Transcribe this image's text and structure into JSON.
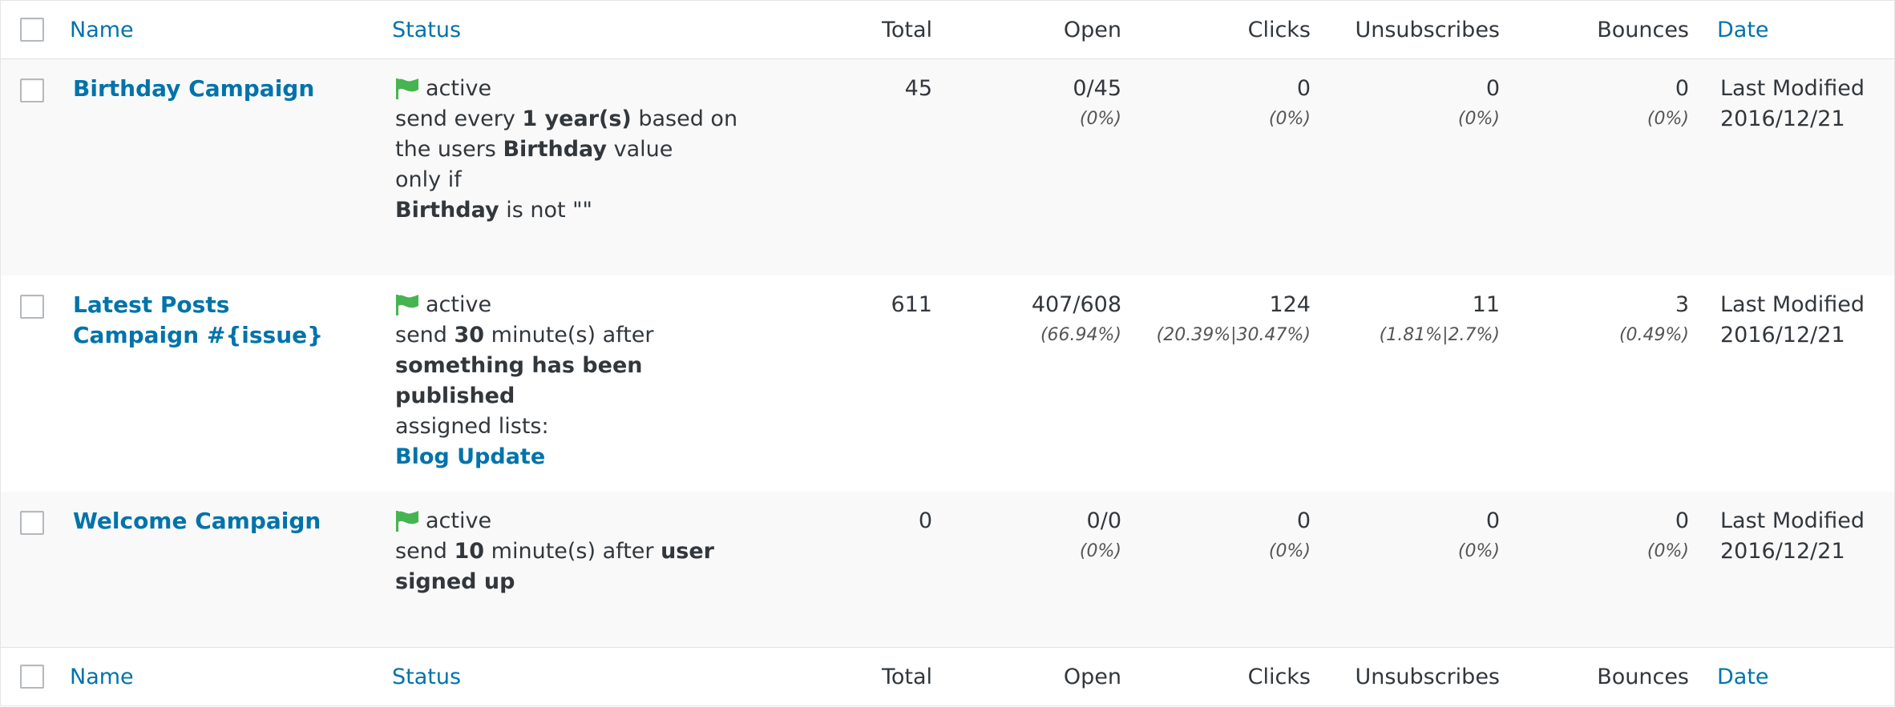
{
  "columns": {
    "name": "Name",
    "status": "Status",
    "total": "Total",
    "open": "Open",
    "clicks": "Clicks",
    "unsubscribes": "Unsubscribes",
    "bounces": "Bounces",
    "date": "Date"
  },
  "campaigns": [
    {
      "name": "Birthday Campaign",
      "status": "active",
      "desc_1a": "send every ",
      "desc_1b": "1 year(s)",
      "desc_1c": " based on the users ",
      "desc_1d": "Birthday",
      "desc_1e": " value",
      "desc_2": "only if",
      "desc_3a": "Birthday",
      "desc_3b": " is not \"\"",
      "total": "45",
      "open": "0/45",
      "open_pct": "(0%)",
      "clicks": "0",
      "clicks_pct": "(0%)",
      "unsubscribes": "0",
      "unsubscribes_pct": "(0%)",
      "bounces": "0",
      "bounces_pct": "(0%)",
      "date_label": "Last Modified",
      "date": "2016/12/21"
    },
    {
      "name": "Latest Posts Campaign #{issue}",
      "status": "active",
      "desc_1a": "send ",
      "desc_1b": "30",
      "desc_1c": " minute(s) after ",
      "desc_1d": "something has been published",
      "desc_2": "assigned lists:",
      "list_link": "Blog Update",
      "total": "611",
      "open": "407/608",
      "open_pct": "(66.94%)",
      "clicks": "124",
      "clicks_pct": "(20.39%|30.47%)",
      "unsubscribes": "11",
      "unsubscribes_pct": "(1.81%|2.7%)",
      "bounces": "3",
      "bounces_pct": "(0.49%)",
      "date_label": "Last Modified",
      "date": "2016/12/21"
    },
    {
      "name": "Welcome Campaign",
      "status": "active",
      "desc_1a": "send ",
      "desc_1b": "10",
      "desc_1c": " minute(s) after ",
      "desc_1d": "user signed up",
      "total": "0",
      "open": "0/0",
      "open_pct": "(0%)",
      "clicks": "0",
      "clicks_pct": "(0%)",
      "unsubscribes": "0",
      "unsubscribes_pct": "(0%)",
      "bounces": "0",
      "bounces_pct": "(0%)",
      "date_label": "Last Modified",
      "date": "2016/12/21"
    }
  ],
  "icons": {
    "status_flag": "green-flag-icon"
  },
  "colors": {
    "link": "#0073aa",
    "flag": "#46b450",
    "row_alt": "#f9f9f9"
  }
}
